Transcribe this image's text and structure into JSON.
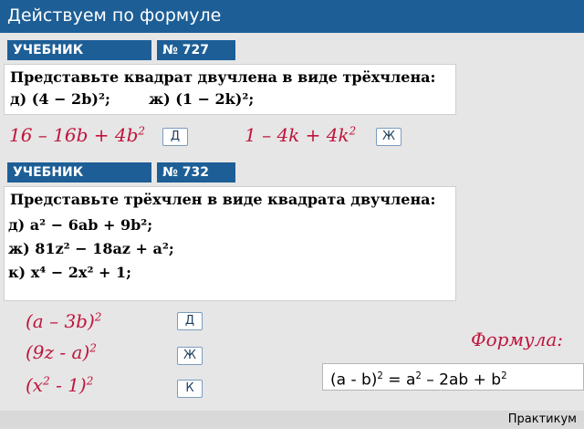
{
  "header": {
    "title": "Действуем по формуле"
  },
  "section1": {
    "book_label": "УЧЕБНИК",
    "number_label": "№ 727",
    "task_title": "Представьте квадрат двучлена в виде трёхчлена:",
    "item_d": "д)  (4 − 2b)²;",
    "item_zh": "ж)  (1 − 2k)²;",
    "answer_d": {
      "text": "16 – 16b + 4b",
      "sup": "2"
    },
    "answer_zh": {
      "text": "1 – 4k + 4k",
      "sup": "2"
    },
    "key_d": "Д",
    "key_zh": "Ж"
  },
  "section2": {
    "book_label": "УЧЕБНИК",
    "number_label": "№ 732",
    "task_title": "Представьте трёхчлен в виде квадрата двучлена:",
    "item_d": "д)  a² − 6ab + 9b²;",
    "item_zh": "ж)  81z² − 18az + a²;",
    "item_k": "к)  x⁴ − 2x² + 1;",
    "answer_d": {
      "text": "(a – 3b)",
      "sup": "2"
    },
    "answer_zh": {
      "text": "(9z - a)",
      "sup": "2"
    },
    "answer_k": {
      "pre": "(x",
      "sup1": "2",
      "mid": " - 1)",
      "sup2": "2"
    },
    "key_d": "Д",
    "key_zh": "Ж",
    "key_k": "К"
  },
  "formula": {
    "label": "Формула:",
    "p1": "(a - b)",
    "s1": "2",
    "p2": " = a",
    "s2": "2",
    "p3": " – 2ab + b",
    "s3": "2"
  },
  "footer": {
    "label": "Практикум"
  },
  "colors": {
    "header": "#1d5e96",
    "answer": "#c0143c",
    "band": "#e6e6e6"
  }
}
